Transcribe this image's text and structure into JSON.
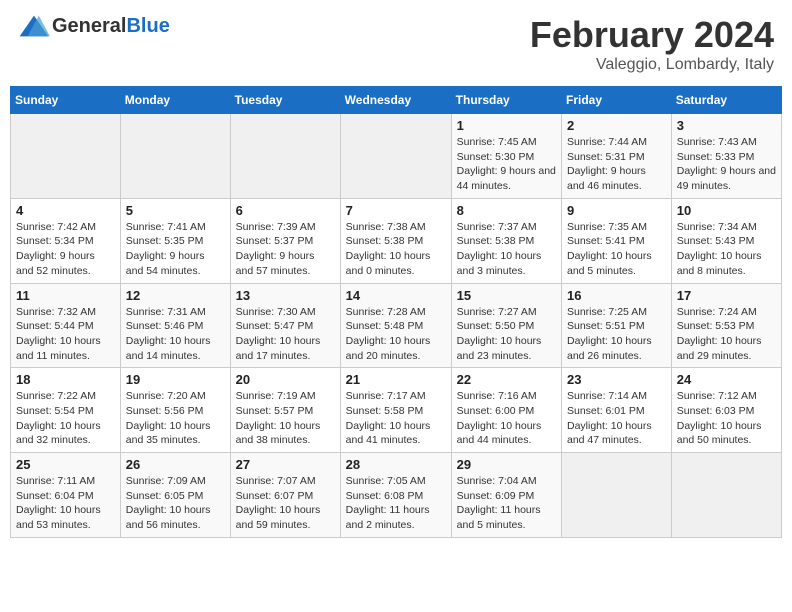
{
  "header": {
    "logo_text_general": "General",
    "logo_text_blue": "Blue",
    "month_title": "February 2024",
    "location": "Valeggio, Lombardy, Italy"
  },
  "calendar": {
    "days_of_week": [
      "Sunday",
      "Monday",
      "Tuesday",
      "Wednesday",
      "Thursday",
      "Friday",
      "Saturday"
    ],
    "weeks": [
      [
        {
          "day": "",
          "info": ""
        },
        {
          "day": "",
          "info": ""
        },
        {
          "day": "",
          "info": ""
        },
        {
          "day": "",
          "info": ""
        },
        {
          "day": "1",
          "info": "Sunrise: 7:45 AM\nSunset: 5:30 PM\nDaylight: 9 hours and 44 minutes."
        },
        {
          "day": "2",
          "info": "Sunrise: 7:44 AM\nSunset: 5:31 PM\nDaylight: 9 hours and 46 minutes."
        },
        {
          "day": "3",
          "info": "Sunrise: 7:43 AM\nSunset: 5:33 PM\nDaylight: 9 hours and 49 minutes."
        }
      ],
      [
        {
          "day": "4",
          "info": "Sunrise: 7:42 AM\nSunset: 5:34 PM\nDaylight: 9 hours and 52 minutes."
        },
        {
          "day": "5",
          "info": "Sunrise: 7:41 AM\nSunset: 5:35 PM\nDaylight: 9 hours and 54 minutes."
        },
        {
          "day": "6",
          "info": "Sunrise: 7:39 AM\nSunset: 5:37 PM\nDaylight: 9 hours and 57 minutes."
        },
        {
          "day": "7",
          "info": "Sunrise: 7:38 AM\nSunset: 5:38 PM\nDaylight: 10 hours and 0 minutes."
        },
        {
          "day": "8",
          "info": "Sunrise: 7:37 AM\nSunset: 5:38 PM\nDaylight: 10 hours and 3 minutes."
        },
        {
          "day": "9",
          "info": "Sunrise: 7:35 AM\nSunset: 5:41 PM\nDaylight: 10 hours and 5 minutes."
        },
        {
          "day": "10",
          "info": "Sunrise: 7:34 AM\nSunset: 5:43 PM\nDaylight: 10 hours and 8 minutes."
        }
      ],
      [
        {
          "day": "11",
          "info": "Sunrise: 7:32 AM\nSunset: 5:44 PM\nDaylight: 10 hours and 11 minutes."
        },
        {
          "day": "12",
          "info": "Sunrise: 7:31 AM\nSunset: 5:46 PM\nDaylight: 10 hours and 14 minutes."
        },
        {
          "day": "13",
          "info": "Sunrise: 7:30 AM\nSunset: 5:47 PM\nDaylight: 10 hours and 17 minutes."
        },
        {
          "day": "14",
          "info": "Sunrise: 7:28 AM\nSunset: 5:48 PM\nDaylight: 10 hours and 20 minutes."
        },
        {
          "day": "15",
          "info": "Sunrise: 7:27 AM\nSunset: 5:50 PM\nDaylight: 10 hours and 23 minutes."
        },
        {
          "day": "16",
          "info": "Sunrise: 7:25 AM\nSunset: 5:51 PM\nDaylight: 10 hours and 26 minutes."
        },
        {
          "day": "17",
          "info": "Sunrise: 7:24 AM\nSunset: 5:53 PM\nDaylight: 10 hours and 29 minutes."
        }
      ],
      [
        {
          "day": "18",
          "info": "Sunrise: 7:22 AM\nSunset: 5:54 PM\nDaylight: 10 hours and 32 minutes."
        },
        {
          "day": "19",
          "info": "Sunrise: 7:20 AM\nSunset: 5:56 PM\nDaylight: 10 hours and 35 minutes."
        },
        {
          "day": "20",
          "info": "Sunrise: 7:19 AM\nSunset: 5:57 PM\nDaylight: 10 hours and 38 minutes."
        },
        {
          "day": "21",
          "info": "Sunrise: 7:17 AM\nSunset: 5:58 PM\nDaylight: 10 hours and 41 minutes."
        },
        {
          "day": "22",
          "info": "Sunrise: 7:16 AM\nSunset: 6:00 PM\nDaylight: 10 hours and 44 minutes."
        },
        {
          "day": "23",
          "info": "Sunrise: 7:14 AM\nSunset: 6:01 PM\nDaylight: 10 hours and 47 minutes."
        },
        {
          "day": "24",
          "info": "Sunrise: 7:12 AM\nSunset: 6:03 PM\nDaylight: 10 hours and 50 minutes."
        }
      ],
      [
        {
          "day": "25",
          "info": "Sunrise: 7:11 AM\nSunset: 6:04 PM\nDaylight: 10 hours and 53 minutes."
        },
        {
          "day": "26",
          "info": "Sunrise: 7:09 AM\nSunset: 6:05 PM\nDaylight: 10 hours and 56 minutes."
        },
        {
          "day": "27",
          "info": "Sunrise: 7:07 AM\nSunset: 6:07 PM\nDaylight: 10 hours and 59 minutes."
        },
        {
          "day": "28",
          "info": "Sunrise: 7:05 AM\nSunset: 6:08 PM\nDaylight: 11 hours and 2 minutes."
        },
        {
          "day": "29",
          "info": "Sunrise: 7:04 AM\nSunset: 6:09 PM\nDaylight: 11 hours and 5 minutes."
        },
        {
          "day": "",
          "info": ""
        },
        {
          "day": "",
          "info": ""
        }
      ]
    ]
  }
}
